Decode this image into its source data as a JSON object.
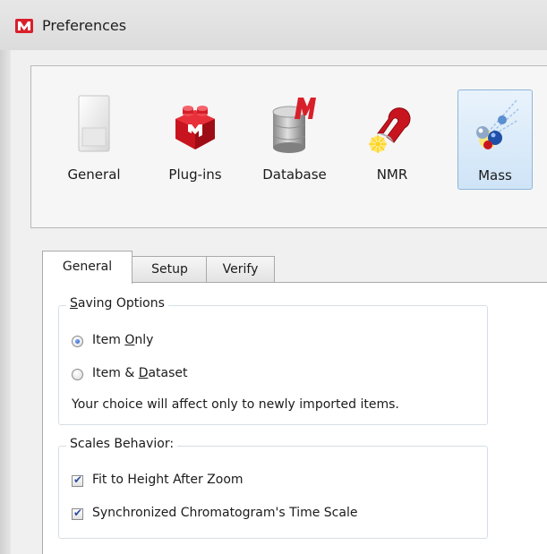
{
  "window": {
    "title": "Preferences",
    "app_icon": "mnova-logo-icon"
  },
  "toolbar": {
    "items": [
      {
        "label": "General",
        "icon": "general-page-icon",
        "selected": false
      },
      {
        "label": "Plug-ins",
        "icon": "plugin-brick-icon",
        "selected": false
      },
      {
        "label": "Database",
        "icon": "database-cylinder-icon",
        "selected": false
      },
      {
        "label": "NMR",
        "icon": "nmr-magnet-icon",
        "selected": false
      },
      {
        "label": "Mass",
        "icon": "mass-molecules-icon",
        "selected": true
      }
    ]
  },
  "tabs": [
    {
      "label": "General",
      "active": true
    },
    {
      "label": "Setup",
      "active": false
    },
    {
      "label": "Verify",
      "active": false
    }
  ],
  "saving_options": {
    "title": "Saving Options",
    "title_parts": [
      "",
      "S",
      "aving Options"
    ],
    "options": [
      {
        "label": "Item Only",
        "parts": [
          "Item ",
          "O",
          "nly"
        ],
        "checked": true
      },
      {
        "label": "Item & Dataset",
        "parts": [
          "Item & ",
          "D",
          "ataset"
        ],
        "checked": false
      }
    ],
    "note": "Your choice will affect only to newly imported  items."
  },
  "scales_behavior": {
    "title": "Scales Behavior:",
    "options": [
      {
        "label": "Fit to Height After Zoom",
        "checked": true
      },
      {
        "label": "Synchronized Chromatogram's Time Scale",
        "checked": true
      }
    ]
  },
  "colors": {
    "selected_fill": "#cfe4f7",
    "selected_border": "#8fb5da",
    "dialog_bg": "#f0f0f0",
    "check_color": "#2a4e9e",
    "brand_red": "#d8202a"
  }
}
